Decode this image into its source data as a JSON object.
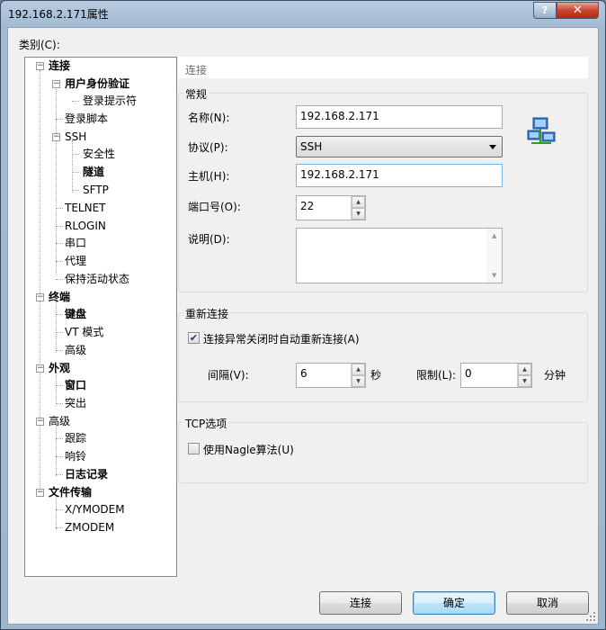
{
  "window": {
    "title": "192.168.2.171属性",
    "help_label": "?",
    "close_label": "✕"
  },
  "category_label": "类别(C):",
  "tree": {
    "items": [
      {
        "label": "连接",
        "bold": true,
        "selected": false
      },
      {
        "label": "用户身份验证",
        "bold": true
      },
      {
        "label": "登录提示符",
        "bold": false
      },
      {
        "label": "登录脚本",
        "bold": false
      },
      {
        "label": "SSH",
        "bold": false
      },
      {
        "label": "安全性",
        "bold": false
      },
      {
        "label": "隧道",
        "bold": true
      },
      {
        "label": "SFTP",
        "bold": false
      },
      {
        "label": "TELNET",
        "bold": false
      },
      {
        "label": "RLOGIN",
        "bold": false
      },
      {
        "label": "串口",
        "bold": false
      },
      {
        "label": "代理",
        "bold": false
      },
      {
        "label": "保持活动状态",
        "bold": false
      },
      {
        "label": "终端",
        "bold": true
      },
      {
        "label": "键盘",
        "bold": true
      },
      {
        "label": "VT 模式",
        "bold": false
      },
      {
        "label": "高级",
        "bold": false
      },
      {
        "label": "外观",
        "bold": true
      },
      {
        "label": "窗口",
        "bold": true
      },
      {
        "label": "突出",
        "bold": false
      },
      {
        "label": "高级",
        "bold": false
      },
      {
        "label": "跟踪",
        "bold": false
      },
      {
        "label": "响铃",
        "bold": false
      },
      {
        "label": "日志记录",
        "bold": true
      },
      {
        "label": "文件传输",
        "bold": true
      },
      {
        "label": "X/YMODEM",
        "bold": false
      },
      {
        "label": "ZMODEM",
        "bold": false
      }
    ]
  },
  "panel_header": "连接",
  "general": {
    "title": "常规",
    "name_label": "名称(N):",
    "name_value": "192.168.2.171",
    "protocol_label": "协议(P):",
    "protocol_value": "SSH",
    "host_label": "主机(H):",
    "host_value": "192.168.2.171",
    "port_label": "端口号(O):",
    "port_value": "22",
    "desc_label": "说明(D):",
    "desc_value": ""
  },
  "reconnect": {
    "title": "重新连接",
    "auto_label": "连接异常关闭时自动重新连接(A)",
    "auto_checked": true,
    "interval_label": "间隔(V):",
    "interval_value": "6",
    "interval_unit": "秒",
    "limit_label": "限制(L):",
    "limit_value": "0",
    "limit_unit": "分钟"
  },
  "tcp": {
    "title": "TCP选项",
    "nagle_label": "使用Nagle算法(U)",
    "nagle_checked": false
  },
  "buttons": {
    "connect": "连接",
    "ok": "确定",
    "cancel": "取消"
  },
  "icons": {
    "network": "network-computers-icon"
  }
}
